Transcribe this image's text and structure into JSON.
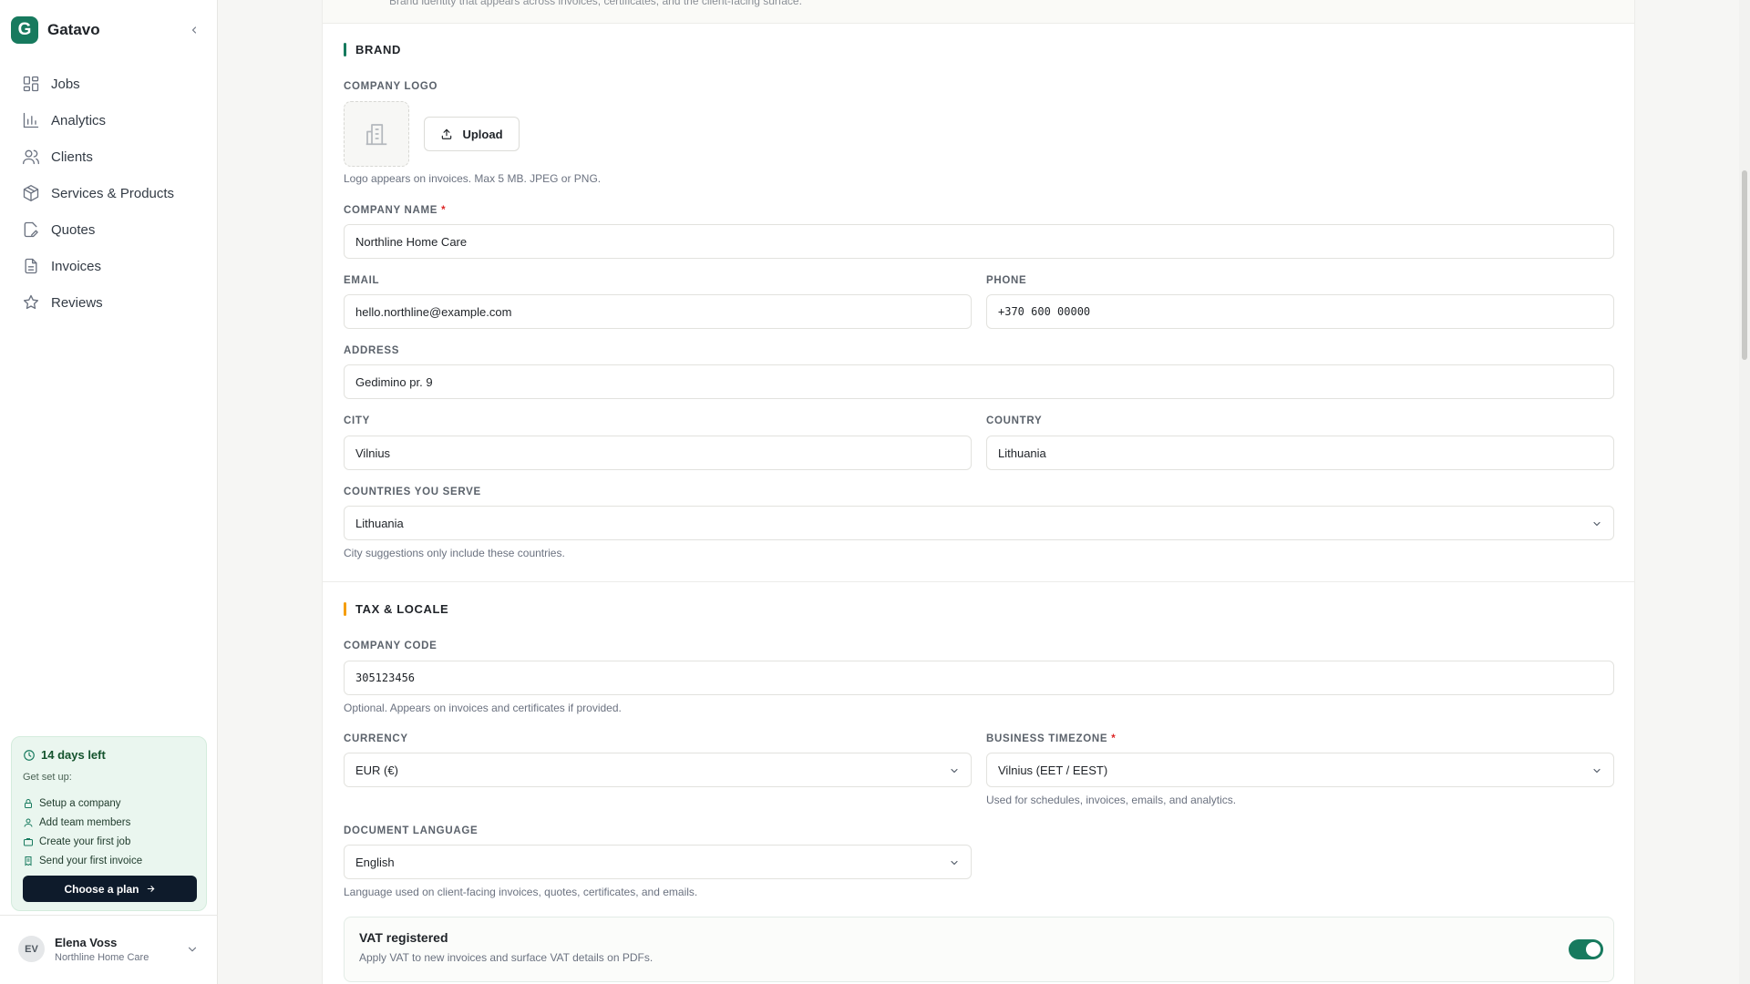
{
  "app": {
    "name": "Gatavo",
    "logo_letter": "G"
  },
  "sidebar": {
    "items": [
      {
        "label": "Jobs",
        "icon": "grid-icon"
      },
      {
        "label": "Analytics",
        "icon": "bar-chart-icon"
      },
      {
        "label": "Clients",
        "icon": "users-icon"
      },
      {
        "label": "Services & Products",
        "icon": "package-icon"
      },
      {
        "label": "Quotes",
        "icon": "file-edit-icon"
      },
      {
        "label": "Invoices",
        "icon": "file-text-icon"
      },
      {
        "label": "Reviews",
        "icon": "star-icon"
      }
    ]
  },
  "trial": {
    "title": "14 days left",
    "subtitle": "Get set up:",
    "steps": [
      "Setup a company",
      "Add team members",
      "Create your first job",
      "Send your first invoice"
    ],
    "cta": "Choose a plan"
  },
  "user": {
    "initials": "EV",
    "name": "Elena Voss",
    "company": "Northline Home Care"
  },
  "top_strip_text": "Brand identity that appears across invoices, certificates, and the client-facing surface.",
  "brand_section": {
    "title": "BRAND",
    "logo_label": "COMPANY LOGO",
    "upload_label": "Upload",
    "logo_help": "Logo appears on invoices. Max 5 MB. JPEG or PNG.",
    "company_name_label": "COMPANY NAME",
    "company_name": "Northline Home Care",
    "email_label": "EMAIL",
    "email": "hello.northline@example.com",
    "phone_label": "PHONE",
    "phone": "+370 600 00000",
    "address_label": "ADDRESS",
    "address": "Gedimino pr. 9",
    "city_label": "CITY",
    "city": "Vilnius",
    "country_label": "COUNTRY",
    "country": "Lithuania",
    "serve_label": "COUNTRIES YOU SERVE",
    "serve_value": "Lithuania",
    "serve_help": "City suggestions only include these countries."
  },
  "tax_section": {
    "title": "TAX & LOCALE",
    "company_code_label": "COMPANY CODE",
    "company_code": "305123456",
    "company_code_help": "Optional. Appears on invoices and certificates if provided.",
    "currency_label": "CURRENCY",
    "currency": "EUR (€)",
    "timezone_label": "BUSINESS TIMEZONE",
    "timezone": "Vilnius (EET / EEST)",
    "timezone_help": "Used for schedules, invoices, emails, and analytics.",
    "language_label": "DOCUMENT LANGUAGE",
    "language": "English",
    "language_help": "Language used on client-facing invoices, quotes, certificates, and emails.",
    "vat_title": "VAT registered",
    "vat_desc": "Apply VAT to new invoices and surface VAT details on PDFs.",
    "vat_enabled": true
  },
  "colors": {
    "brand_green": "#177a5e",
    "brand_accent": "#177a5e",
    "tax_accent": "#f59e0b",
    "required": "#dc2626",
    "plan_button": "#0e1b2b"
  }
}
